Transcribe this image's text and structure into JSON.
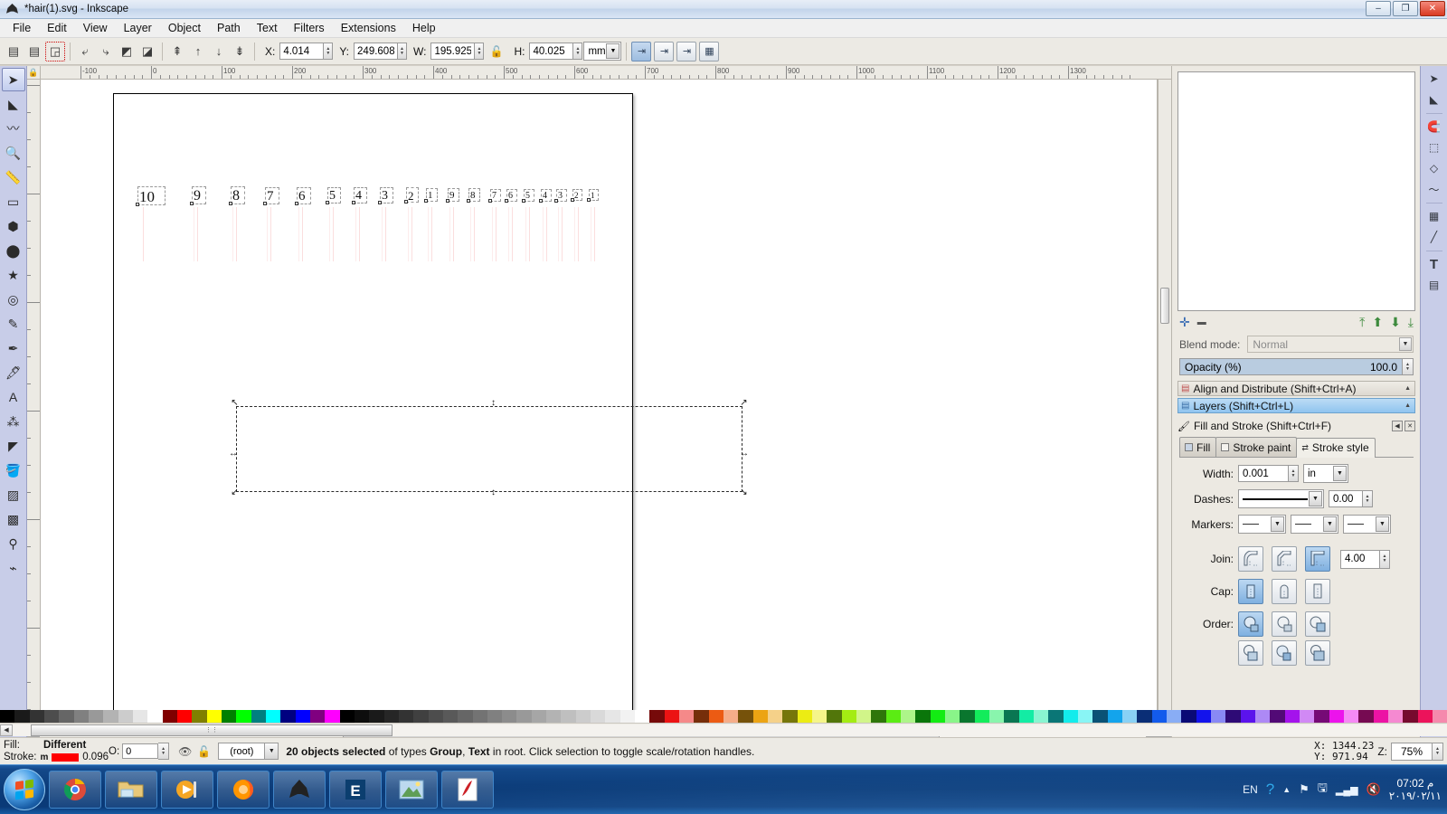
{
  "window": {
    "title": "*hair(1).svg - Inkscape",
    "app_icon": "inkscape-logo-icon",
    "buttons": {
      "minimize": "‒",
      "maximize": "❐",
      "close": "✕"
    }
  },
  "menubar": {
    "items": [
      "File",
      "Edit",
      "View",
      "Layer",
      "Object",
      "Path",
      "Text",
      "Filters",
      "Extensions",
      "Help"
    ]
  },
  "command_toolbar": {
    "left_buttons": [
      {
        "name": "document-properties-icon",
        "glyph": "▤"
      },
      {
        "name": "layers-dialog-icon",
        "glyph": "▤"
      },
      {
        "name": "selection-preview-icon",
        "glyph": "◲"
      }
    ],
    "transform_buttons": [
      {
        "name": "rotate-90-ccw-icon",
        "glyph": "⤶"
      },
      {
        "name": "rotate-90-cw-icon",
        "glyph": "⤷"
      },
      {
        "name": "flip-horizontal-icon",
        "glyph": "◩"
      },
      {
        "name": "flip-vertical-icon",
        "glyph": "◪"
      }
    ],
    "zorder_buttons": [
      {
        "name": "raise-to-top-icon",
        "glyph": "⇞"
      },
      {
        "name": "raise-icon",
        "glyph": "↑"
      },
      {
        "name": "lower-icon",
        "glyph": "↓"
      },
      {
        "name": "lower-to-bottom-icon",
        "glyph": "⇟"
      }
    ],
    "fields": {
      "x_label": "X:",
      "x_value": "4.014",
      "y_label": "Y:",
      "y_value": "249.608",
      "w_label": "W:",
      "w_value": "195.925",
      "h_label": "H:",
      "h_value": "40.025",
      "lock_icon": "lock-open-icon",
      "units": "mm"
    },
    "affect_toggles": [
      {
        "name": "scale-stroke-width-toggle",
        "glyph": "⇥",
        "on": true
      },
      {
        "name": "scale-rounded-corners-toggle",
        "glyph": "⇥",
        "on": false
      },
      {
        "name": "move-gradients-toggle",
        "glyph": "⇥",
        "on": false
      },
      {
        "name": "move-patterns-toggle",
        "glyph": "▦",
        "on": false
      }
    ]
  },
  "toolbox": [
    {
      "name": "selector-tool",
      "glyph": "➤",
      "active": true
    },
    {
      "name": "node-tool",
      "glyph": "◣"
    },
    {
      "name": "tweak-tool",
      "glyph": "〰"
    },
    {
      "name": "zoom-tool",
      "glyph": "🔍"
    },
    {
      "name": "measure-tool",
      "glyph": "📏"
    },
    {
      "name": "rectangle-tool",
      "glyph": "▭"
    },
    {
      "name": "box3d-tool",
      "glyph": "⬢"
    },
    {
      "name": "ellipse-tool",
      "glyph": "⬤"
    },
    {
      "name": "star-tool",
      "glyph": "★"
    },
    {
      "name": "spiral-tool",
      "glyph": "◎"
    },
    {
      "name": "pencil-tool",
      "glyph": "✎"
    },
    {
      "name": "bezier-tool",
      "glyph": "✒"
    },
    {
      "name": "calligraphy-tool",
      "glyph": "🖋"
    },
    {
      "name": "text-tool",
      "glyph": "A"
    },
    {
      "name": "spray-tool",
      "glyph": "⁂"
    },
    {
      "name": "eraser-tool",
      "glyph": "◤"
    },
    {
      "name": "bucket-tool",
      "glyph": "🪣"
    },
    {
      "name": "gradient-tool",
      "glyph": "▨"
    },
    {
      "name": "mesh-tool",
      "glyph": "▩"
    },
    {
      "name": "dropper-tool",
      "glyph": "⚲"
    },
    {
      "name": "connector-tool",
      "glyph": "⌁"
    }
  ],
  "rulers": {
    "horizontal_ticks": [
      "-100",
      "0",
      "100",
      "200",
      "300",
      "400",
      "500",
      "600",
      "700",
      "800",
      "900",
      "1000",
      "1100",
      "1200",
      "1300"
    ],
    "vertical_ticks": [
      "0",
      "100",
      "200",
      "300",
      "400",
      "500",
      "600"
    ]
  },
  "canvas": {
    "numbers": [
      "10",
      "9",
      "8",
      "7",
      "6",
      "5",
      "4",
      "3",
      "2",
      "1",
      "9",
      "8",
      "7",
      "6",
      "5",
      "4",
      "3",
      "2",
      "1"
    ],
    "selection_hint": "selection-arrows"
  },
  "right_dock": {
    "layer_buttons": [
      {
        "name": "add-layer-icon",
        "glyph": "✛"
      },
      {
        "name": "remove-layer-icon",
        "glyph": "▬"
      },
      {
        "name": "layer-to-top-icon",
        "glyph": "⤒"
      },
      {
        "name": "raise-layer-icon",
        "glyph": "⬆"
      },
      {
        "name": "lower-layer-icon",
        "glyph": "⬇"
      },
      {
        "name": "layer-to-bottom-icon",
        "glyph": "⤓"
      }
    ],
    "blend_mode_label": "Blend mode:",
    "blend_mode_value": "Normal",
    "opacity_label": "Opacity (%)",
    "opacity_value": "100.0",
    "panels": [
      {
        "name": "align-and-distribute",
        "title": "Align and Distribute (Shift+Ctrl+A)",
        "icon": "align-icon",
        "active": false
      },
      {
        "name": "layers",
        "title": "Layers (Shift+Ctrl+L)",
        "icon": "layers-icon",
        "active": true
      }
    ],
    "fill_stroke": {
      "title": "Fill and Stroke (Shift+Ctrl+F)",
      "header_buttons": [
        {
          "name": "dock-collapse-button",
          "glyph": "◀"
        },
        {
          "name": "dock-close-button",
          "glyph": "✕"
        }
      ],
      "tabs": [
        {
          "name": "tab-fill",
          "label": "Fill",
          "active": false
        },
        {
          "name": "tab-stroke-paint",
          "label": "Stroke paint",
          "active": false
        },
        {
          "name": "tab-stroke-style",
          "label": "Stroke style",
          "active": true
        }
      ],
      "width_label": "Width:",
      "width_value": "0.001",
      "width_unit": "in",
      "dashes_label": "Dashes:",
      "dash_offset": "0.00",
      "markers_label": "Markers:",
      "join_label": "Join:",
      "miter_limit": "4.00",
      "cap_label": "Cap:",
      "order_label": "Order:"
    }
  },
  "right_icon_strip": [
    {
      "name": "new-document-icon",
      "glyph": "🗋"
    },
    {
      "name": "open-document-icon",
      "glyph": "📂"
    },
    {
      "name": "save-document-icon",
      "glyph": "💾"
    },
    {
      "name": "print-document-icon",
      "glyph": "🖶"
    },
    {
      "name": "import-icon",
      "glyph": "⤵"
    },
    {
      "name": "export-icon",
      "glyph": "⤴"
    },
    {
      "name": "undo-icon",
      "glyph": "↩"
    },
    {
      "name": "redo-icon",
      "glyph": "↪"
    },
    {
      "name": "copy-icon",
      "glyph": "⧉"
    },
    {
      "name": "cut-icon",
      "glyph": "✂"
    },
    {
      "name": "paste-icon",
      "glyph": "📋"
    },
    {
      "name": "zoom-selection-icon",
      "glyph": "⌕"
    },
    {
      "name": "zoom-drawing-icon",
      "glyph": "⌕"
    },
    {
      "name": "zoom-page-icon",
      "glyph": "⌕"
    },
    {
      "name": "duplicate-icon",
      "glyph": "⧉"
    },
    {
      "name": "group-icon",
      "glyph": "▣"
    },
    {
      "name": "ungroup-icon",
      "glyph": "▢"
    }
  ],
  "right_icon_strip2": [
    {
      "name": "selector-shortcut-icon",
      "glyph": "➤"
    },
    {
      "name": "node-shortcut-icon",
      "glyph": "◣"
    },
    {
      "name": "snap-enable-icon",
      "glyph": "🧲"
    },
    {
      "name": "snap-bbox-icon",
      "glyph": "⬚"
    },
    {
      "name": "snap-node-icon",
      "glyph": "◇"
    },
    {
      "name": "snap-path-icon",
      "glyph": "〜"
    },
    {
      "name": "snap-grid-icon",
      "glyph": "▦"
    },
    {
      "name": "snap-guide-icon",
      "glyph": "╱"
    },
    {
      "name": "text-shortcut-icon",
      "glyph": "T"
    },
    {
      "name": "xml-editor-icon",
      "glyph": "▤"
    }
  ],
  "statusbar": {
    "fill_label": "Fill:",
    "fill_value": "Different",
    "stroke_label": "Stroke:",
    "stroke_prefix": "m",
    "stroke_width": "0.096",
    "opacity_label": "O:",
    "opacity_value": "0",
    "visibility_icon": "eye-icon",
    "lock_icon": "lock-icon",
    "layer_name": "(root)",
    "message_parts": [
      {
        "text": "20 objects selected",
        "bold": true
      },
      {
        "text": " of types ",
        "bold": false
      },
      {
        "text": "Group",
        "bold": true
      },
      {
        "text": ", ",
        "bold": false
      },
      {
        "text": "Text",
        "bold": true
      },
      {
        "text": " in root. Click selection to toggle scale/rotation handles.",
        "bold": false
      }
    ],
    "cursor_x_label": "X:",
    "cursor_x": "1344.23",
    "cursor_y_label": "Y:",
    "cursor_y": "971.94",
    "zoom_label": "Z:",
    "zoom_value": "75%"
  },
  "taskbar": {
    "start_name": "windows-start-orb",
    "apps": [
      {
        "name": "chrome-taskbar-icon",
        "glyph": "chrome"
      },
      {
        "name": "file-explorer-taskbar-icon",
        "glyph": "folder"
      },
      {
        "name": "media-player-taskbar-icon",
        "glyph": "media"
      },
      {
        "name": "firefox-taskbar-icon",
        "glyph": "firefox"
      },
      {
        "name": "inkscape-taskbar-icon",
        "glyph": "inkscape"
      },
      {
        "name": "e-app-taskbar-icon",
        "glyph": "E"
      },
      {
        "name": "photo-viewer-taskbar-icon",
        "glyph": "photo"
      },
      {
        "name": "pdf-reader-taskbar-icon",
        "glyph": "pdf"
      }
    ],
    "language": "EN",
    "tray_icons": [
      {
        "name": "action-center-icon",
        "glyph": "?"
      },
      {
        "name": "show-hidden-icons-icon",
        "glyph": "▲"
      },
      {
        "name": "network-flag-icon",
        "glyph": "⚑"
      },
      {
        "name": "removable-media-icon",
        "glyph": "🖫"
      },
      {
        "name": "signal-bars-icon",
        "glyph": "▂▄▆"
      },
      {
        "name": "volume-muted-icon",
        "glyph": "🔇"
      }
    ],
    "time": "07:02 م",
    "date": "٢٠١٩/٠٢/١١"
  },
  "palette_colors": [
    "#000000",
    "#1a1a1a",
    "#333333",
    "#4d4d4d",
    "#666666",
    "#808080",
    "#999999",
    "#b3b3b3",
    "#cccccc",
    "#e6e6e6",
    "#ffffff",
    "#800000",
    "#ff0000",
    "#808000",
    "#ffff00",
    "#008000",
    "#00ff00",
    "#008080",
    "#00ffff",
    "#000080",
    "#0000ff",
    "#800080",
    "#ff00ff"
  ]
}
